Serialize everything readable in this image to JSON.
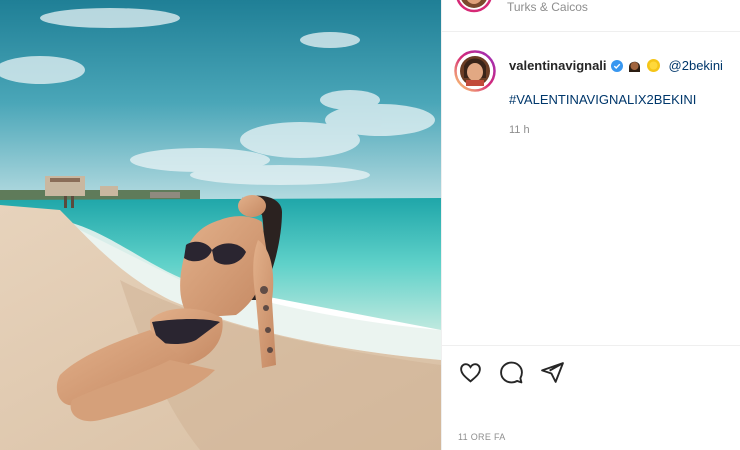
{
  "post": {
    "location": "Turks & Caicos",
    "username": "valentinavignali",
    "emojis": [
      "woman-emoji",
      "sun-emoji"
    ],
    "mention": "@2bekini",
    "hashtag": "#VALENTINAVIGNALIX2BEKINI",
    "caption_time": "11 h",
    "date_label": "11 ORE FA"
  },
  "colors": {
    "link": "#00376b",
    "muted": "#8e8e8e",
    "verified": "#3897f0",
    "avatar_ring": "#d62976"
  }
}
